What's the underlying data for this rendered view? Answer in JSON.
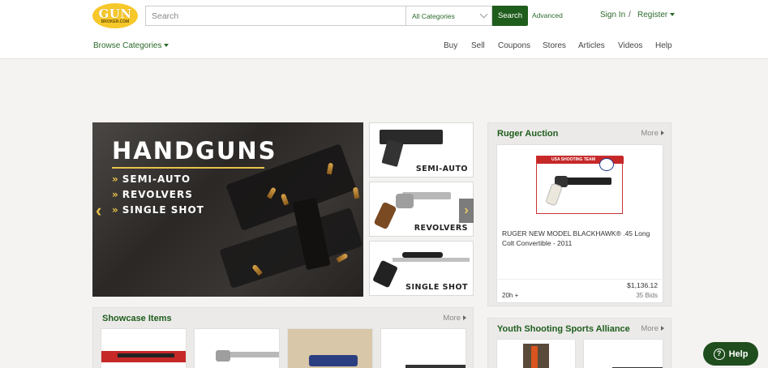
{
  "logo": {
    "main": "GUN",
    "sub": "BROKER.COM"
  },
  "search": {
    "placeholder": "Search",
    "category": "All Categories",
    "button": "Search",
    "advanced": "Advanced"
  },
  "account": {
    "signin": "Sign In",
    "separator": "/",
    "register": "Register"
  },
  "browse": {
    "label": "Browse Categories"
  },
  "nav": {
    "items": [
      "Buy",
      "Sell",
      "Coupons",
      "Stores",
      "Articles",
      "Videos",
      "Help"
    ]
  },
  "hero": {
    "title": "HANDGUNS",
    "items": [
      "SEMI-AUTO",
      "REVOLVERS",
      "SINGLE SHOT"
    ],
    "bullet_glyph": "»",
    "prev_glyph": "‹",
    "next_glyph": "›"
  },
  "tiles": [
    "SEMI-AUTO",
    "REVOLVERS",
    "SINGLE SHOT"
  ],
  "ruger": {
    "title": "Ruger Auction",
    "more": "More",
    "image_band": "USA SHOOTING TEAM",
    "item_title": "RUGER NEW MODEL BLACKHAWK® .45 Long Colt Convertible - 2011",
    "price": "$1,136.12",
    "time": "20h +",
    "bids": "35 Bids"
  },
  "showcase": {
    "title": "Showcase Items",
    "more": "More"
  },
  "yssa": {
    "title": "Youth Shooting Sports Alliance",
    "more": "More"
  },
  "help_button": {
    "label": "Help",
    "icon": "?"
  },
  "colors": {
    "brand_green": "#1f5d1d",
    "logo_yellow": "#f6c82a",
    "accent_gold": "#e8c34a"
  }
}
